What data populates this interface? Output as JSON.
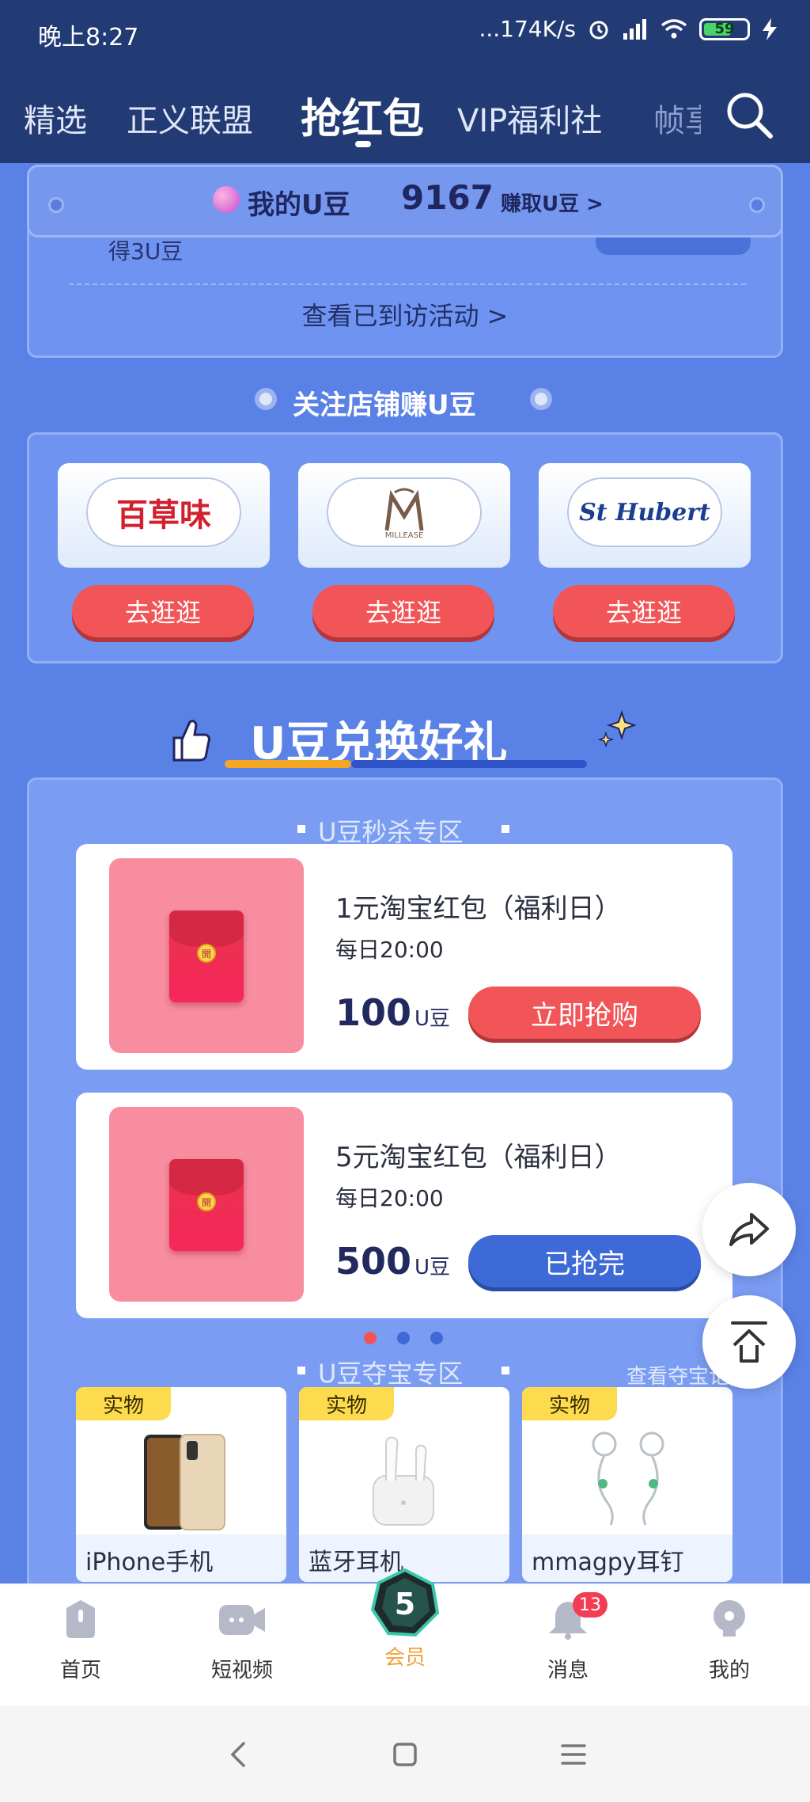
{
  "status_bar": {
    "time": "晚上8:27",
    "network_speed": "...174K/s",
    "battery": "59",
    "battery_level": 0.59
  },
  "top_nav": {
    "tabs": [
      "精选",
      "正义联盟",
      "抢红包",
      "VIP福利社",
      "帧享"
    ],
    "active_tab": "抢红包"
  },
  "u_bean": {
    "label": "我的U豆",
    "count": "9167",
    "earn_link": "赚取U豆 >"
  },
  "visit_activity": {
    "reward_text": "得3U豆",
    "view_visited": "查看已到访活动 >"
  },
  "follow_stores": {
    "title": "关注店铺赚U豆",
    "stores": [
      {
        "logo": "百草味",
        "button": "去逛逛"
      },
      {
        "logo": "MILLEASE",
        "button": "去逛逛"
      },
      {
        "logo": "St Hubert",
        "button": "去逛逛"
      }
    ]
  },
  "exchange": {
    "title": "U豆兑换好礼",
    "flash_sale": {
      "title": "U豆秒杀专区",
      "items": [
        {
          "name": "1元淘宝红包（福利日）",
          "time": "每日20:00",
          "price": "100",
          "unit": "U豆",
          "button": "立即抢购",
          "button_color": "#f25557"
        },
        {
          "name": "5元淘宝红包（福利日）",
          "time": "每日20:00",
          "price": "500",
          "unit": "U豆",
          "button": "已抢完",
          "button_color": "#3d6ad6"
        }
      ],
      "envelope_seal": "開"
    },
    "treasure": {
      "title": "U豆夺宝专区",
      "view_record": "查看夺宝记录>",
      "items": [
        {
          "tag": "实物",
          "name": "iPhone手机"
        },
        {
          "tag": "实物",
          "name": "蓝牙耳机"
        },
        {
          "tag": "实物",
          "name": "mmagpy耳钉"
        }
      ]
    }
  },
  "bottom_nav": {
    "items": [
      "首页",
      "短视频",
      "会员",
      "消息",
      "我的"
    ],
    "active": "会员",
    "member_badge": "5",
    "message_count": "13"
  },
  "colors": {
    "header_bg": "#233b74",
    "page_bg": "#5a82e6",
    "accent_red": "#f25557",
    "accent_blue": "#3d6ad6",
    "member_active": "#f0a03c"
  }
}
